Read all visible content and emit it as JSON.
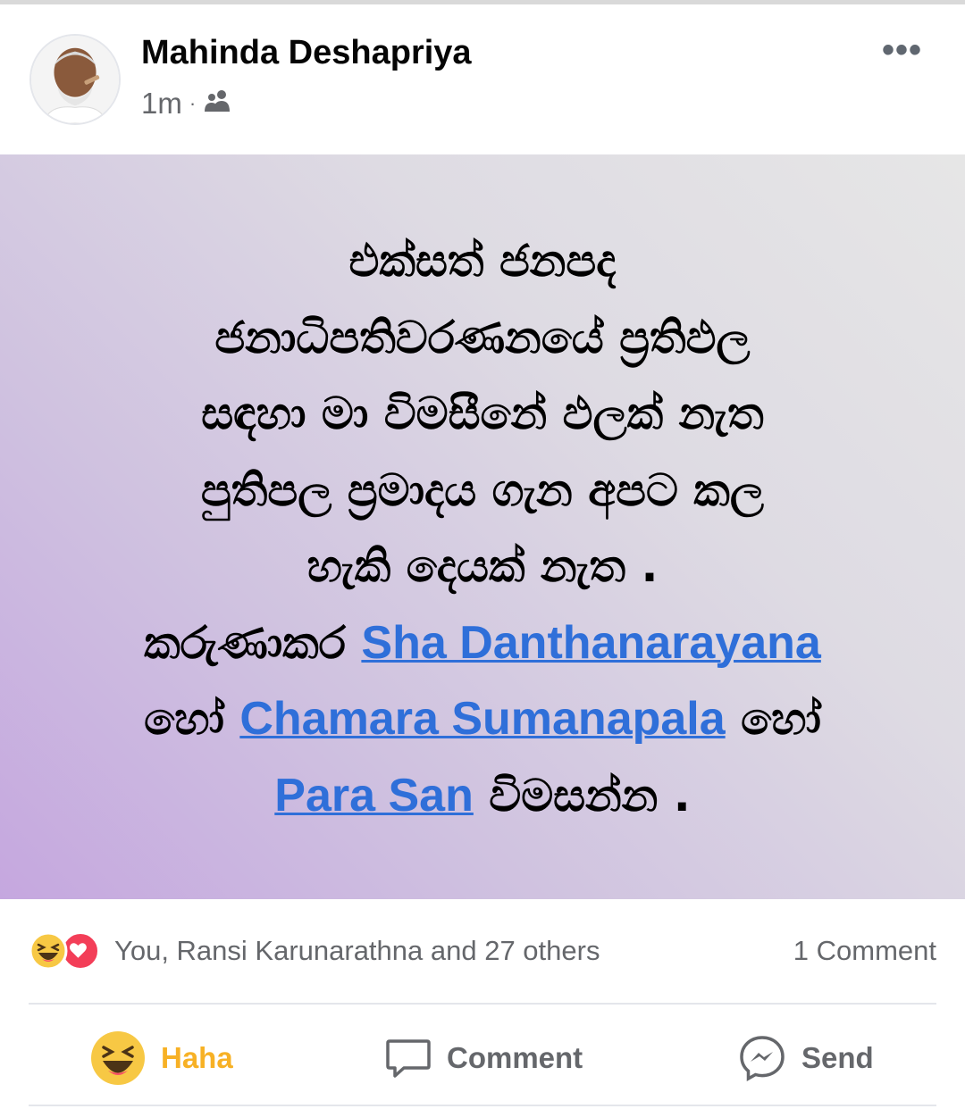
{
  "post": {
    "author": "Mahinda Deshapriya",
    "time": "1m",
    "separator": "·",
    "audience_icon": "friends-icon",
    "more_icon": "more-options-icon",
    "more_glyph": "•••",
    "lines": [
      {
        "text": "එක්සත් ජනපද"
      },
      {
        "text": "ජනාධිපතිවරණනයේ ප්‍රතිඵල"
      },
      {
        "text": "සඳහා මා  විමසීනේ ඵලක් නැත"
      },
      {
        "text": "පුතිපල ප්‍රමාදය  ගැන අපට කල"
      },
      {
        "text": "හැකි දෙයක් නැත ."
      },
      {
        "before": "කරුණාකර  ",
        "link": "Sha Danthanarayana",
        "after": ""
      },
      {
        "before": "හෝ ",
        "link": "Chamara Sumanapala",
        "after": "  හෝ"
      },
      {
        "before": "",
        "link": "Para San",
        "after": "  විමසන්න ."
      }
    ],
    "link_color": "#2f6fd9"
  },
  "reactions": {
    "icons": [
      "haha-icon",
      "love-icon"
    ],
    "summary": "You, Ransi Karunarathna and 27 others",
    "comments": "1 Comment"
  },
  "actions": [
    {
      "label": "Haha",
      "icon": "haha-icon",
      "color": "#f7b125"
    },
    {
      "label": "Comment",
      "icon": "comment-icon"
    },
    {
      "label": "Send",
      "icon": "messenger-icon"
    }
  ]
}
